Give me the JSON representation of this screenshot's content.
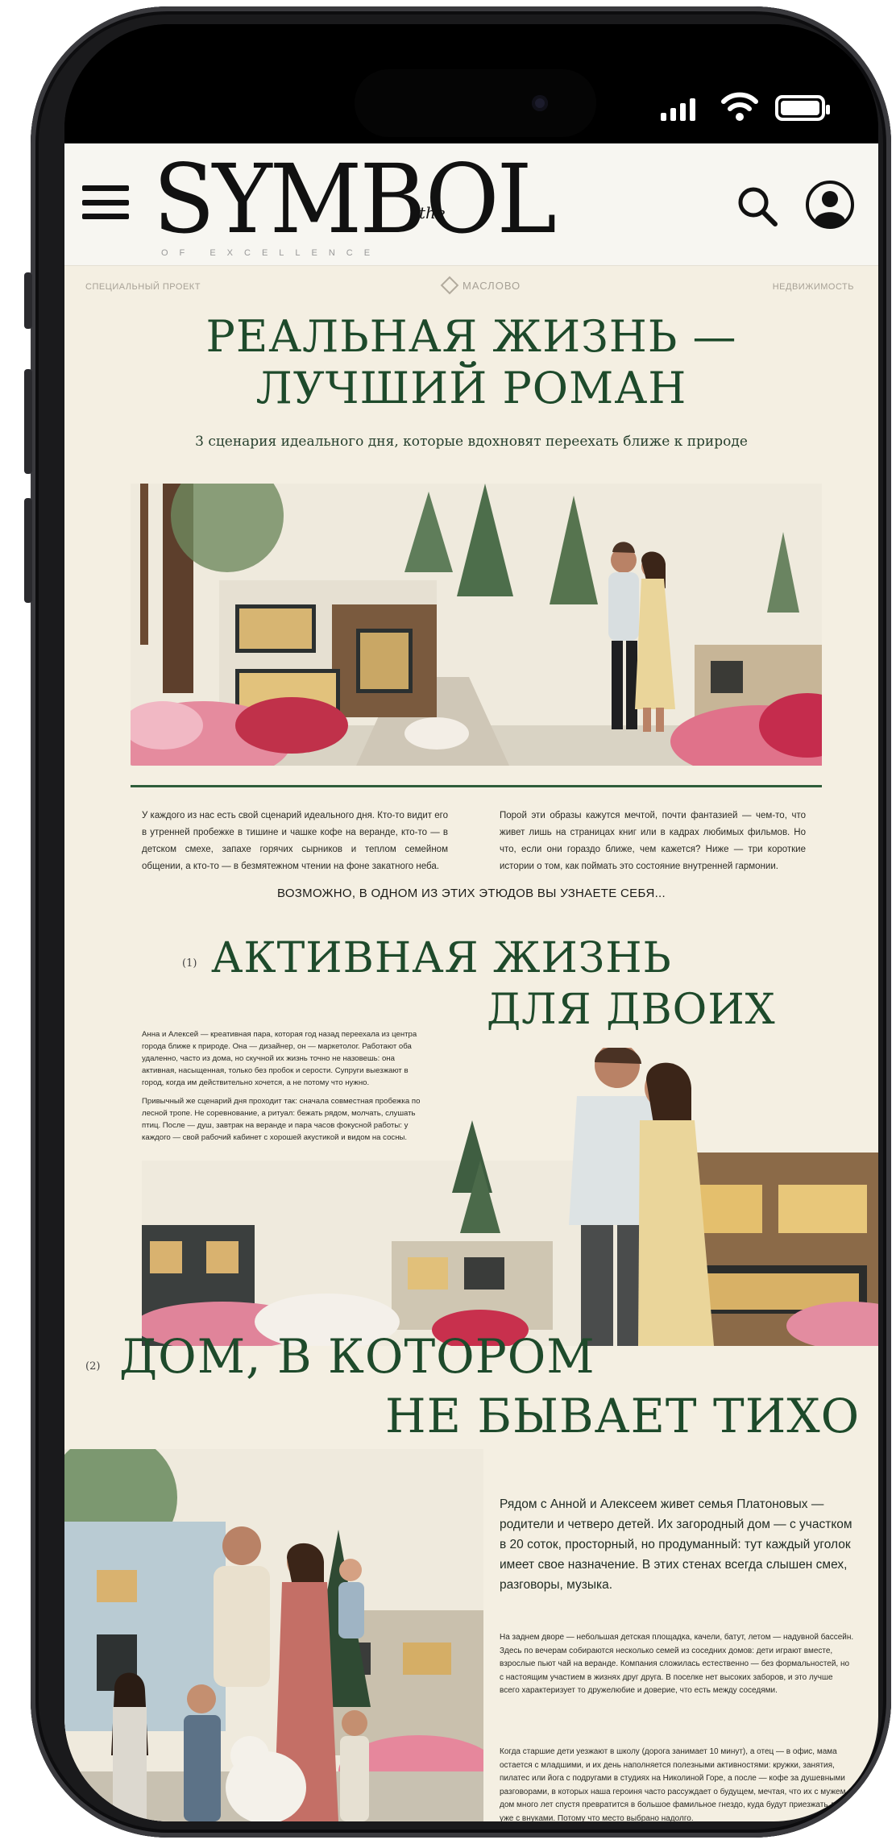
{
  "site": {
    "logo": "SYMBOL",
    "logo_the": "the",
    "logo_sub": "OF EXCELLENCE"
  },
  "article": {
    "meta_left": "СПЕЦИАЛЬНЫЙ ПРОЕКТ",
    "meta_center": "МАСЛОВО",
    "meta_right": "НЕДВИЖИМОСТЬ",
    "title_line1": "РЕАЛЬНАЯ ЖИЗНЬ —",
    "title_line2": "ЛУЧШИЙ РОМАН",
    "subtitle": "3 сценария идеального дня, которые вдохновят переехать ближе к природе",
    "intro_left": "У каждого из нас есть свой сценарий идеального дня. Кто-то видит его в утренней пробежке в тишине и чашке кофе на веранде, кто-то — в детском смехе, запахе горячих сырников и теплом семейном общении, а кто-то — в безмятежном чтении на фоне закатного неба.",
    "intro_right": "Порой эти образы кажутся мечтой, почти фантазией — чем-то, что живет лишь на страницах книг или в кадрах любимых фильмов. Но что, если они гораздо ближе, чем кажется? Ниже — три короткие истории о том, как поймать это состояние внутренней гармонии.",
    "lead_in": "ВОЗМОЖНО, В ОДНОМ ИЗ ЭТИХ ЭТЮДОВ ВЫ УЗНАЕТЕ СЕБЯ..."
  },
  "section1": {
    "number": "(1)",
    "title_line1": "АКТИВНАЯ ЖИЗНЬ",
    "title_line2": "ДЛЯ ДВОИХ",
    "p1": "Анна и Алексей — креативная пара, которая год назад переехала из центра города ближе к природе. Она — дизайнер, он — маркетолог. Работают оба удаленно, часто из дома, но скучной их жизнь точно не назовешь: она активная, насыщенная, только без пробок и серости. Супруги выезжают в город, когда им действительно хочется, а не потому что нужно.",
    "p2": "Привычный же сценарий дня проходит так: сначала совместная пробежка по лесной тропе. Не соревнование, а ритуал: бежать рядом, молчать, слушать птиц. После — душ, завтрак на веранде и пара часов фокусной работы: у каждого — свой рабочий кабинет с хорошей акустикой и видом на сосны."
  },
  "section2": {
    "number": "(2)",
    "title_line1": "ДОМ, В КОТОРОМ",
    "title_line2": "НЕ БЫВАЕТ ТИХО",
    "lead": "Рядом с Анной и Алексеем живет семья Платоновых — родители и четверо детей. Их загородный дом — с участком в 20 соток, просторный, но продуманный: тут каждый уголок имеет свое назначение. В этих стенах всегда слышен смех, разговоры, музыка.",
    "p1": "На заднем дворе — небольшая детская площадка, качели, батут, летом — надувной бассейн. Здесь по вечерам собираются несколько семей из соседних домов: дети играют вместе, взрослые пьют чай на веранде. Компания сложилась естественно — без формальностей, но с настоящим участием в жизнях друг друга. В поселке нет высоких заборов, и это лучше всего характеризует то дружелюбие и доверие, что есть между соседями.",
    "p2": "Когда старшие дети уезжают в школу (дорога занимает 10 минут), а отец — в офис, мама остается с младшими, и их день наполняется полезными активностями: кружки, занятия, пилатес или йога с подругами в студиях на Николиной Горе, а после — кофе за душевными разговорами, в которых наша героиня часто рассуждает о будущем, мечтая, что их с мужем дом много лет спустя превратится в большое фамильное гнездо, куда будут приезжать дети уже с внуками. Потому что место выбрано надолго."
  }
}
